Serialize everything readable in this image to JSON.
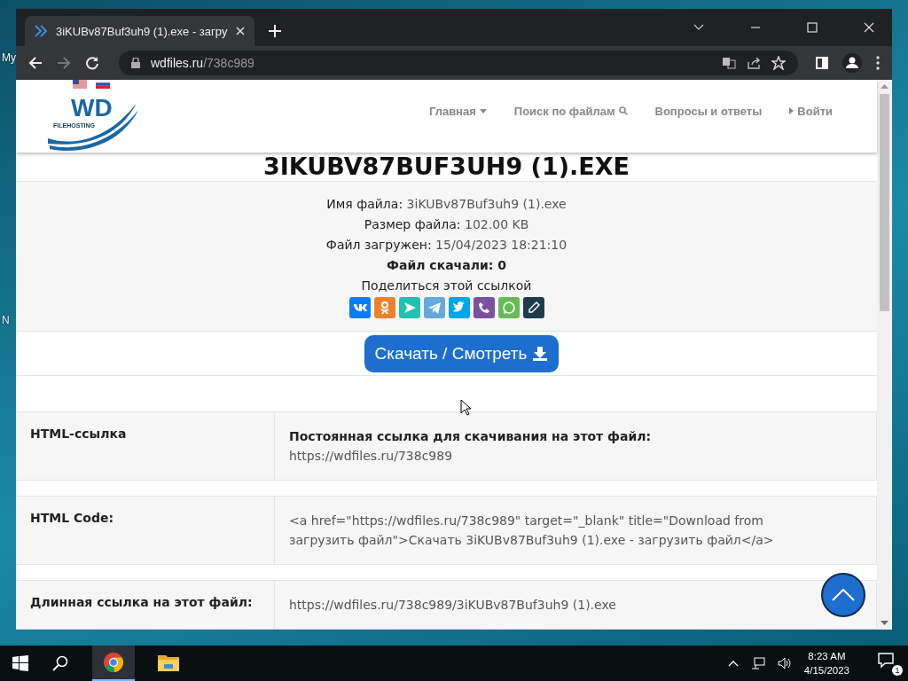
{
  "desktop": {
    "labels": [
      "My",
      "N"
    ]
  },
  "browser": {
    "tab": {
      "title": "3iKUBv87Buf3uh9 (1).exe - загру",
      "selected": true
    },
    "address": {
      "host": "wdfiles.ru",
      "path": "/738c989"
    }
  },
  "site": {
    "flags": [
      {
        "kind": "us"
      },
      {
        "kind": "ru"
      }
    ],
    "logo": {
      "letters": "WD",
      "caption": "FILEHOSTING"
    },
    "nav": [
      {
        "label": "Главная",
        "kind": "dropdown"
      },
      {
        "label": "Поиск по файлам",
        "kind": "search"
      },
      {
        "label": "Вопросы и ответы",
        "kind": "plain"
      },
      {
        "label": "Войти",
        "kind": "login"
      }
    ]
  },
  "file": {
    "title": "3IKUBV87BUF3UH9 (1).EXE",
    "info": [
      {
        "label": "Имя файла:",
        "value": "3iKUBv87Buf3uh9 (1).exe",
        "bold": false
      },
      {
        "label": "Размер файла:",
        "value": "102.00 KB",
        "bold": false
      },
      {
        "label": "Файл загружен:",
        "value": "15/04/2023 18:21:10",
        "bold": false
      },
      {
        "label": "Файл скачали:",
        "value": "0",
        "bold": true
      }
    ],
    "share_caption": "Поделиться этой ссылкой",
    "share": [
      {
        "kind": "vk",
        "color": "#0a7cf2"
      },
      {
        "kind": "ok",
        "color": "#ed812b"
      },
      {
        "kind": "send",
        "color": "#20c2b0"
      },
      {
        "kind": "telegram",
        "color": "#64a9dc"
      },
      {
        "kind": "twitter",
        "color": "#00a6e8"
      },
      {
        "kind": "viber",
        "color": "#7b519d"
      },
      {
        "kind": "whatsapp",
        "color": "#65bc54"
      },
      {
        "kind": "edit",
        "color": "#1d3d4f"
      }
    ],
    "download_button": "Скачать / Смотреть"
  },
  "links": [
    {
      "header": "HTML-ссылка",
      "label": "Постоянная ссылка для скачивания на этот файл:",
      "value": "https://wdfiles.ru/738c989"
    },
    {
      "header": "HTML Code:",
      "value": "<a href=\"https://wdfiles.ru/738c989\" target=\"_blank\" title=\"Download from загрузить файл\">Скачать 3iKUBv87Buf3uh9 (1).exe - загрузить файл</a>"
    },
    {
      "header": "Длинная ссылка на этот файл:",
      "value": "https://wdfiles.ru/738c989/3iKUBv87Buf3uh9 (1).exe"
    }
  ],
  "taskbar": {
    "time": "8:23 AM",
    "date": "4/15/2023",
    "notifications": "1",
    "apps": [
      {
        "kind": "chrome",
        "selected": true
      },
      {
        "kind": "folder",
        "selected": false
      }
    ]
  }
}
